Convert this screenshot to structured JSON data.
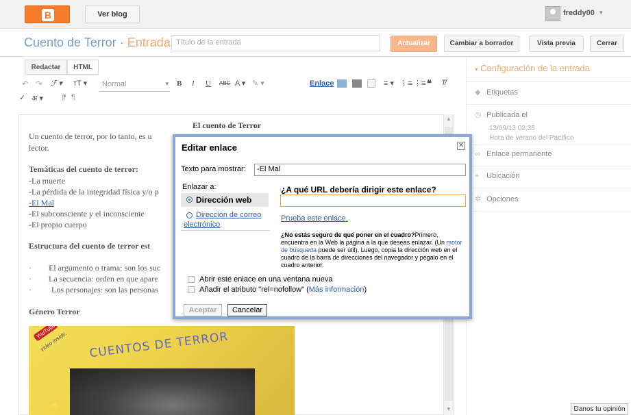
{
  "topbar": {
    "view_blog_label": "Ver blog",
    "user_name": "freddy00",
    "user_caret": "▾"
  },
  "title_row": {
    "blog_name": "Cuento de Terror",
    "separator": "·",
    "section": "Entrada",
    "title_placeholder": "Título de la entrada",
    "update_label": "Actualizar",
    "draft_label": "Cambiar a borrador",
    "preview_label": "Vista previa",
    "close_label": "Cerrar"
  },
  "editor": {
    "tab_compose": "Redactar",
    "tab_html": "HTML",
    "font_style": "Normal",
    "link_tool": "Enlace"
  },
  "document": {
    "title": "El cuento de Terror",
    "intro_line1": "Un cuento de terror, por lo tanto, es u",
    "intro_line2": "lector.",
    "themes_heading": "Temáticas del cuento de terror:",
    "themes": [
      "-La muerte",
      "-La pérdida de la integridad física y/o p"
    ],
    "link_text": "-El Mal",
    "themes_after": [
      "-El subconsciente y el inconsciente",
      "-El propio cuerpo"
    ],
    "structure_heading": "Estructura del cuento de terror est",
    "structure_items": [
      "El argumento o trama: son los suc",
      "La secuencia: orden en que apare",
      "Los personajes: son las personas"
    ],
    "genre_heading": "Género Terror",
    "image_caption": "CUENTOS DE TERROR",
    "image_badge": "YouTube",
    "image_badge_sub": "video inside."
  },
  "sidebar": {
    "heading": "Configuración de la entrada",
    "labels": "Etiquetas",
    "published": "Publicada el",
    "published_date": "13/09/13 02:35",
    "published_tz": "Hora de verano del Pacífico",
    "permalink": "Enlace permanente",
    "location": "Ubicación",
    "options": "Opciones"
  },
  "feedback_label": "Danos tu opinión",
  "dialog": {
    "title": "Editar enlace",
    "close_glyph": "✕",
    "text_label": "Texto para mostrar:",
    "text_value": "-El Mal",
    "link_to_label": "Enlazar a:",
    "option_web": "Dirección web",
    "option_email_line1": "Dirección de correo",
    "option_email_line2": "electrónico",
    "question": "¿A qué URL debería dirigir este enlace?",
    "url_value": "",
    "test_link": "Prueba este enlace.",
    "help_bold": "¿No estás seguro de qué poner en el cuadro?",
    "help_1": "Primero, encuentra en la Web la página a la que deseas enlazar. (Un ",
    "help_link": "motor de búsqueda",
    "help_2": " puede ser útil). Luego, copia la dirección web en el cuadro de la barra de direcciones del navegador y pégalo en el cuadro anterior.",
    "new_window_label": "Abrir este enlace en una ventana nueva",
    "nofollow_label": "Añadir el atributo \"rel=nofollow\" (",
    "nofollow_more": "Más información",
    "nofollow_close": ")",
    "accept_label": "Aceptar",
    "cancel_label": "Cancelar"
  }
}
